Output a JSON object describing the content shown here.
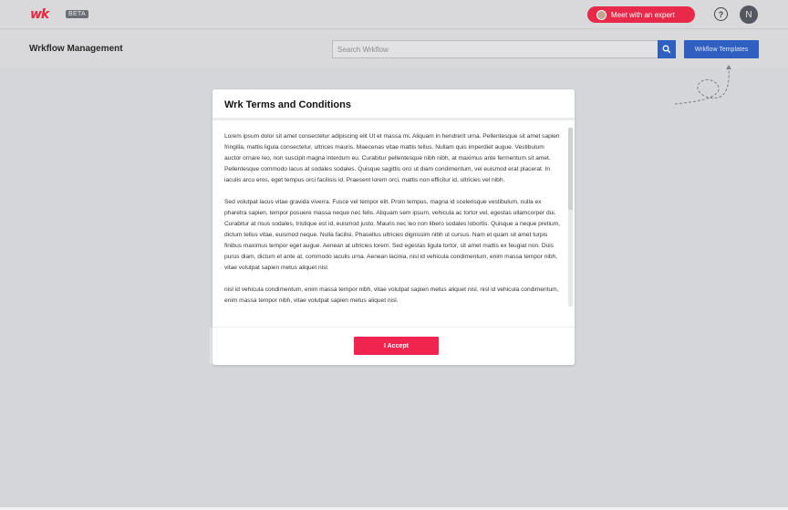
{
  "topbar": {
    "logo_text": "wk",
    "beta_label": "BETA",
    "expert_button_label": "Meet with an expert",
    "help_glyph": "?",
    "user_initial": "N"
  },
  "subheader": {
    "page_title": "Wrkflow Management",
    "search_placeholder": "Search Wrkflow",
    "templates_button_label": "Wrkflow Templates"
  },
  "modal": {
    "title": "Wrk Terms and Conditions",
    "paragraphs": [
      "Lorem ipsum dolor sit amet consectetur adipiscing elit Ut et massa mi. Aliquam in hendrerit urna. Pellentesque sit amet sapien fringilla, mattis ligula consectetur, ultrices mauris. Maecenas vitae mattis tellus. Nullam quis imperdiet augue. Vestibulum auctor ornare leo, non suscipit magna interdum eu. Curabitur pellentesque nibh nibh, at maximus ante fermentum sit amet. Pellentesque commodo lacus at sodales sodales. Quisque sagittis orci ut diam condimentum, vel euismod erat placerat. In iaculis arcu eros, eget tempus orci facilisis id. Praesent lorem orci, mattis non efficitur id, ultricies vel nibh.",
      "Sed volutpat lacus vitae gravida viverra. Fusce vel tempor elit. Proin tempus, magna id scelerisque vestibulum, nulla ex pharetra sapien, tempor posuere massa neque nec felis. Aliquam sem ipsum, vehicula ac tortor vel, egestas ullamcorper dui. Curabitur at risus sodales, tristique est id, euismod justo. Mauris nec leo non libero sodales lobortis. Quisque a neque pretium, dictum tellus vitae, euismod neque. Nulla facilisi. Phasellus ultricies dignissim nibh ut cursus. Nam et quam sit amet turpis finibus maximus tempor eget augue. Aenean at ultricies lorem. Sed egestas ligula tortor, sit amet mattis ex feugiat non. Duis purus diam, dictum et ante at, commodo iaculis urna. Aenean lacinia, nisl id vehicula condimentum, enim massa tempor nibh, vitae volutpat sapien metus aliquet nisl.",
      "nisl id vehicula condimentum, enim massa tempor nibh, vitae volutpat sapien metus aliquet nisl. nisl id vehicula condimentum, enim massa tempor nibh, vitae volutpat sapien metus aliquet nisl."
    ],
    "accept_label": "I Accept"
  },
  "colors": {
    "brand_red": "#e8263f",
    "accent_blue": "#2e5fc1",
    "accept_pink": "#f0244f"
  },
  "icons": {
    "search": "search-icon",
    "help": "help-icon",
    "arrow": "dashed-arrow-icon"
  }
}
